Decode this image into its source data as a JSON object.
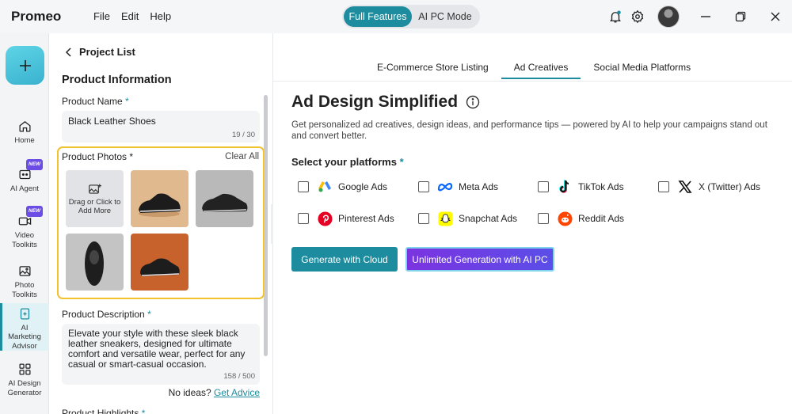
{
  "app": {
    "title": "Promeo",
    "menu": [
      "File",
      "Edit",
      "Help"
    ]
  },
  "mode_switch": {
    "active": "Full Features",
    "inactive": "AI PC Mode"
  },
  "nav": [
    {
      "id": "home",
      "label": "Home",
      "new": false
    },
    {
      "id": "ai-agent",
      "label": "AI Agent",
      "new": true
    },
    {
      "id": "video-toolkits",
      "label": "Video\nToolkits",
      "new": true
    },
    {
      "id": "photo-toolkits",
      "label": "Photo\nToolkits",
      "new": false
    },
    {
      "id": "ai-marketing-advisor",
      "label": "AI\nMarketing\nAdvisor",
      "new": false
    },
    {
      "id": "ai-design-generator",
      "label": "AI Design\nGenerator",
      "new": false
    }
  ],
  "new_badge": "NEW",
  "panel": {
    "back_label": "Project List",
    "section_title": "Product Information",
    "product_name": {
      "label": "Product Name",
      "value": "Black Leather Shoes",
      "counter": "19 / 30"
    },
    "product_photos": {
      "label": "Product Photos",
      "clear_all": "Clear All",
      "upload_text": "Drag or Click to Add More"
    },
    "product_description": {
      "label": "Product Description",
      "value": "Elevate your style with these sleek black leather sneakers, designed for ultimate comfort and versatile wear, perfect for any casual or smart-casual occasion.",
      "counter": "158 / 500"
    },
    "advice": {
      "prompt": "No ideas?",
      "link": "Get Advice"
    },
    "highlights_label": "Product Highlights"
  },
  "tabs": [
    "E-Commerce Store Listing",
    "Ad Creatives",
    "Social Media Platforms"
  ],
  "active_tab": "Ad Creatives",
  "content": {
    "headline": "Ad Design Simplified",
    "subtext": "Get personalized ad creatives, design ideas, and performance tips — powered by AI to help your campaigns stand out and convert better.",
    "select_label": "Select your platforms",
    "platforms": [
      "Google Ads",
      "Meta Ads",
      "TikTok Ads",
      "X (Twitter) Ads",
      "Pinterest Ads",
      "Snapchat Ads",
      "Reddit Ads"
    ],
    "btn_cloud": "Generate with Cloud",
    "btn_aipc": "Unlimited Generation with AI PC"
  },
  "colors": {
    "accent": "#1c8c9e",
    "highlight": "#f2c12e",
    "purple": "#6b3fe4"
  }
}
